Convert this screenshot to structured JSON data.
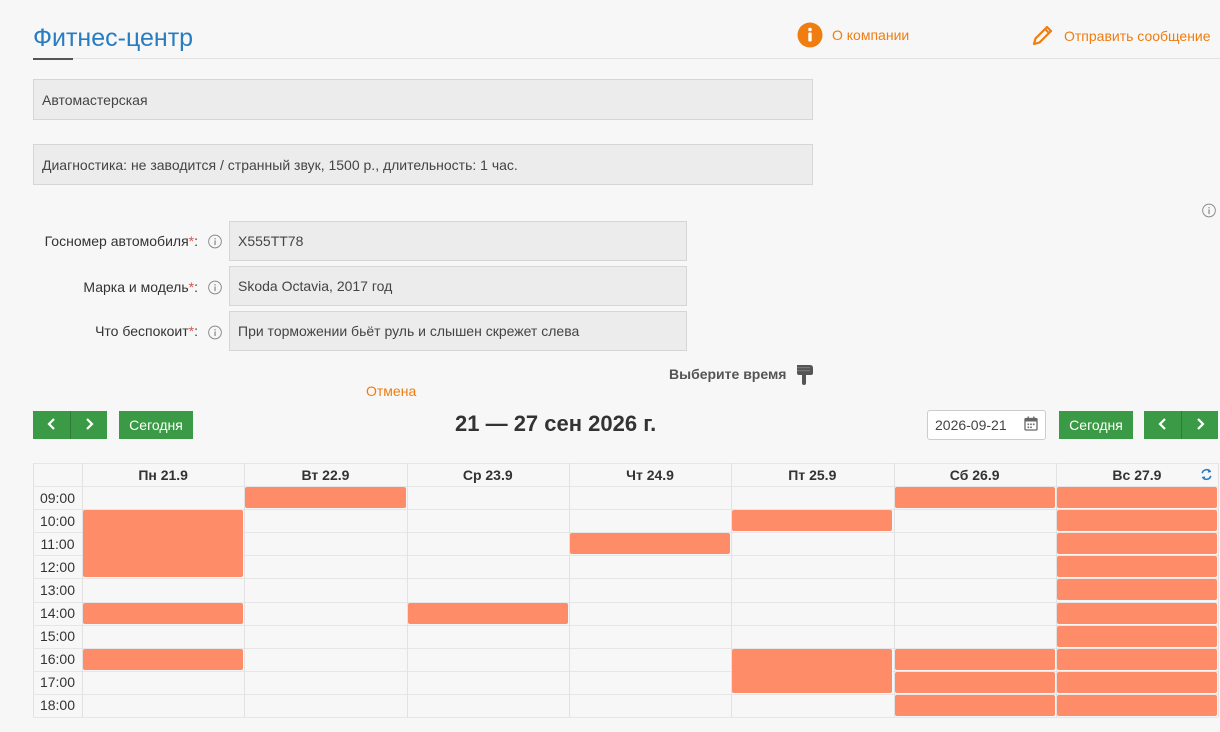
{
  "header": {
    "title": "Фитнес-центр",
    "about_label": "О компании",
    "message_label": "Отправить сообщение"
  },
  "service": {
    "category": "Автомастерская",
    "description": "Диагностика: не заводится / странный звук, 1500 р., длительность: 1 час."
  },
  "form": {
    "fields": [
      {
        "label": "Госномер автомобиля",
        "required": "*",
        "suffix": ":",
        "value": "Х555ТТ78"
      },
      {
        "label": "Марка и модель",
        "required": "*",
        "suffix": ":",
        "value": "Skoda Octavia, 2017 год"
      },
      {
        "label": "Что беспокоит",
        "required": "*",
        "suffix": ":",
        "value": "При торможении бьёт руль и слышен скрежет слева"
      }
    ],
    "cancel_label": "Отмена",
    "choose_time_label": "Выберите время"
  },
  "calendar": {
    "today_label": "Сегодня",
    "week_title": "21 — 27 сен 2026 г.",
    "date_value": "2026-09-21",
    "days": [
      "Пн 21.9",
      "Вт 22.9",
      "Ср 23.9",
      "Чт 24.9",
      "Пт 25.9",
      "Сб 26.9",
      "Вс 27.9"
    ],
    "times": [
      "09:00",
      "10:00",
      "11:00",
      "12:00",
      "13:00",
      "14:00",
      "15:00",
      "16:00",
      "17:00",
      "18:00"
    ],
    "busy": [
      {
        "day": 0,
        "start": 1,
        "length": 3
      },
      {
        "day": 0,
        "start": 5,
        "length": 1
      },
      {
        "day": 0,
        "start": 7,
        "length": 1
      },
      {
        "day": 1,
        "start": 0,
        "length": 1
      },
      {
        "day": 2,
        "start": 5,
        "length": 1
      },
      {
        "day": 3,
        "start": 2,
        "length": 1
      },
      {
        "day": 4,
        "start": 1,
        "length": 1
      },
      {
        "day": 4,
        "start": 7,
        "length": 2
      },
      {
        "day": 5,
        "start": 0,
        "length": 1
      },
      {
        "day": 5,
        "start": 7,
        "length": 1
      },
      {
        "day": 5,
        "start": 8,
        "length": 1
      },
      {
        "day": 5,
        "start": 9,
        "length": 1
      },
      {
        "day": 6,
        "start": 0,
        "length": 1
      },
      {
        "day": 6,
        "start": 1,
        "length": 1
      },
      {
        "day": 6,
        "start": 2,
        "length": 1
      },
      {
        "day": 6,
        "start": 3,
        "length": 1
      },
      {
        "day": 6,
        "start": 4,
        "length": 1
      },
      {
        "day": 6,
        "start": 5,
        "length": 1
      },
      {
        "day": 6,
        "start": 6,
        "length": 1
      },
      {
        "day": 6,
        "start": 7,
        "length": 1
      },
      {
        "day": 6,
        "start": 8,
        "length": 1
      },
      {
        "day": 6,
        "start": 9,
        "length": 1
      }
    ],
    "busy_color": "#ff8c69"
  },
  "colors": {
    "accent": "#ef7d0f",
    "title": "#2a7cc1",
    "green": "#3b9a45"
  },
  "icons": [
    "info-circle-icon",
    "pencil-icon",
    "pointing-hand-icon",
    "chevron-left-icon",
    "chevron-right-icon",
    "calendar-icon",
    "refresh-icon",
    "info-icon"
  ]
}
